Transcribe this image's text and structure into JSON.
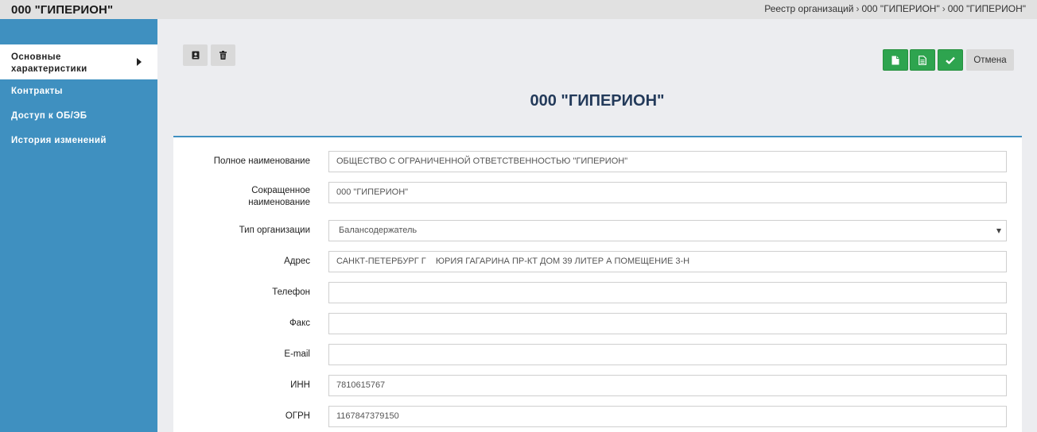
{
  "header": {
    "title": "000 \"ГИПЕРИОН\"",
    "breadcrumb": [
      "Реестр организаций",
      "000 \"ГИПЕРИОН\"",
      "000 \"ГИПЕРИОН\""
    ],
    "separator": "›"
  },
  "sidebar": {
    "items": [
      {
        "label": "Основные характеристики",
        "active": true
      },
      {
        "label": "Контракты"
      },
      {
        "label": "Доступ к ОБ/ЭБ"
      },
      {
        "label": "История изменений"
      }
    ]
  },
  "toolbar": {
    "left_icons": [
      "contact-icon",
      "trash-icon"
    ],
    "right_icons": [
      "document-icon",
      "document-lines-icon",
      "check-icon"
    ],
    "cancel_label": "Отмена"
  },
  "page_title": "000 \"ГИПЕРИОН\"",
  "form": {
    "fields": [
      {
        "label": "Полное наименование",
        "value": "ОБЩЕСТВО С ОГРАНИЧЕННОЙ ОТВЕТСТВЕННОСТЬЮ \"ГИПЕРИОН\""
      },
      {
        "label": "Сокращенное наименование",
        "value": "000 \"ГИПЕРИОН\""
      },
      {
        "label": "Тип организации",
        "value": "Балансодержатель",
        "type": "select"
      },
      {
        "label": "Адрес",
        "value": "САНКТ-ПЕТЕРБУРГ Г    ЮРИЯ ГАГАРИНА ПР-КТ ДОМ 39 ЛИТЕР А ПОМЕЩЕНИЕ 3-Н"
      },
      {
        "label": "Телефон",
        "value": ""
      },
      {
        "label": "Факс",
        "value": ""
      },
      {
        "label": "E-mail",
        "value": ""
      },
      {
        "label": "ИНН",
        "value": "7810615767"
      },
      {
        "label": "ОГРН",
        "value": "1167847379150"
      }
    ]
  },
  "colors": {
    "sidebar": "#3f90c0",
    "accent_green": "#2ea44f",
    "title": "#233a5a"
  }
}
